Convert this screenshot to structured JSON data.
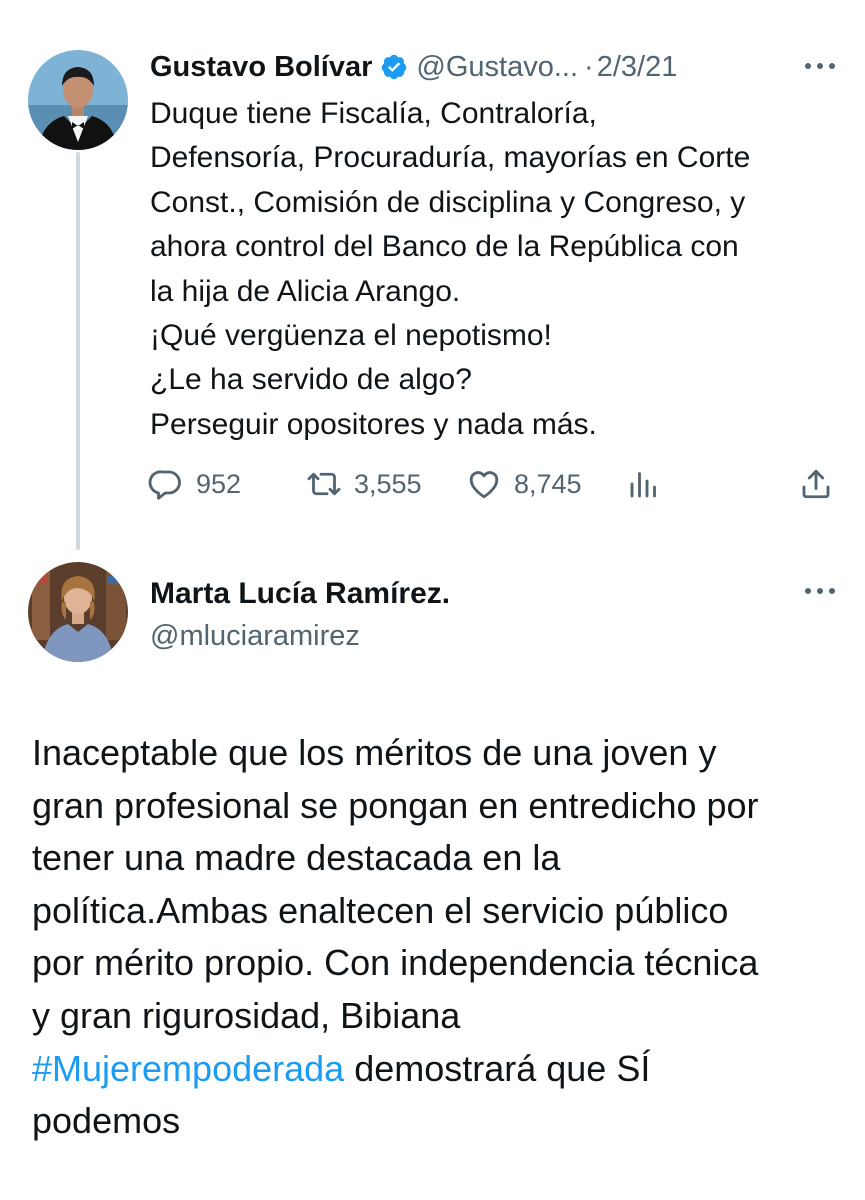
{
  "tweet1": {
    "author": {
      "name": "Gustavo Bolívar",
      "handle": "@Gustavo...",
      "separator": "·",
      "date": "2/3/21",
      "verified_color": "#1d9bf0"
    },
    "text_lines": [
      "Duque tiene Fiscalía, Contraloría,",
      "Defensoría, Procuraduría, mayorías en Corte",
      "Const., Comisión de disciplina y Congreso, y",
      "ahora control del Banco de la República con",
      "la hija de Alicia Arango.",
      "¡Qué vergüenza el nepotismo!",
      "¿Le ha servido de algo?",
      "Perseguir opositores y nada más."
    ],
    "actions": {
      "replies": "952",
      "retweets": "3,555",
      "likes": "8,745",
      "reply_icon": "reply-icon",
      "retweet_icon": "retweet-icon",
      "like_icon": "heart-icon",
      "views_icon": "analytics-icon",
      "share_icon": "share-icon"
    }
  },
  "tweet2": {
    "author": {
      "name": "Marta Lucía Ramírez.",
      "handle": "@mluciaramirez"
    },
    "text_lines": [
      "Inaceptable que los méritos de una joven y",
      "gran profesional se pongan en entredicho por",
      "tener una madre destacada en la",
      "política.Ambas enaltecen el servicio público",
      "por mérito propio. Con independencia técnica",
      "y gran rigurosidad, Bibiana"
    ],
    "hashtag": "#Mujerempoderada",
    "after_hashtag": " demostrará que SÍ",
    "last_line": "podemos"
  },
  "colors": {
    "text": "#0f1419",
    "secondary": "#536471",
    "link": "#1d9bf0",
    "thread_line": "#cfd9de"
  }
}
